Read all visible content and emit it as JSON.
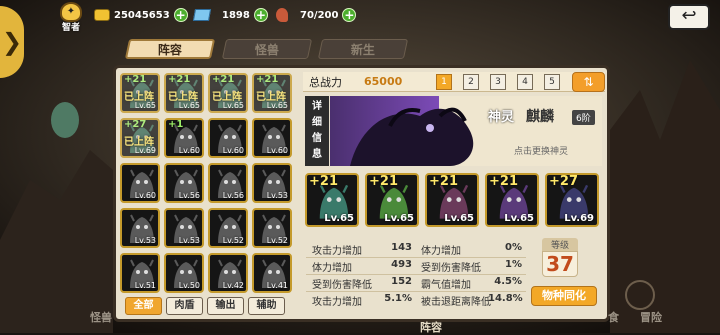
{
  "top": {
    "sage_label": "智者",
    "gold": "25045653",
    "diamond": "1898",
    "stamina": "70/200",
    "back_glyph": "↩"
  },
  "tabs": [
    {
      "label": "阵容",
      "active": true
    },
    {
      "label": "怪兽",
      "active": false
    },
    {
      "label": "新生",
      "active": false
    }
  ],
  "grid_cards": [
    {
      "star": "+21",
      "deployed": "已上阵",
      "level": "Lv.65"
    },
    {
      "star": "+21",
      "deployed": "已上阵",
      "level": "Lv.65"
    },
    {
      "star": "+21",
      "deployed": "已上阵",
      "level": "Lv.65"
    },
    {
      "star": "+21",
      "deployed": "已上阵",
      "level": "Lv.65"
    },
    {
      "star": "+27",
      "deployed": "已上阵",
      "level": "Lv.69"
    },
    {
      "star": "+1",
      "deployed": "",
      "level": "Lv.60"
    },
    {
      "star": "",
      "deployed": "",
      "level": "Lv.60"
    },
    {
      "star": "",
      "deployed": "",
      "level": "Lv.60"
    },
    {
      "star": "",
      "deployed": "",
      "level": "Lv.60"
    },
    {
      "star": "",
      "deployed": "",
      "level": "Lv.56"
    },
    {
      "star": "",
      "deployed": "",
      "level": "Lv.56"
    },
    {
      "star": "",
      "deployed": "",
      "level": "Lv.53"
    },
    {
      "star": "",
      "deployed": "",
      "level": "Lv.53"
    },
    {
      "star": "",
      "deployed": "",
      "level": "Lv.53"
    },
    {
      "star": "",
      "deployed": "",
      "level": "Lv.52"
    },
    {
      "star": "",
      "deployed": "",
      "level": "Lv.52"
    },
    {
      "star": "",
      "deployed": "",
      "level": "Lv.51"
    },
    {
      "star": "",
      "deployed": "",
      "level": "Lv.50"
    },
    {
      "star": "",
      "deployed": "",
      "level": "Lv.42"
    },
    {
      "star": "",
      "deployed": "",
      "level": "Lv.41"
    }
  ],
  "filters": [
    {
      "label": "全部",
      "active": true
    },
    {
      "label": "肉盾",
      "active": false
    },
    {
      "label": "输出",
      "active": false
    },
    {
      "label": "辅助",
      "active": false
    }
  ],
  "power": {
    "label": "总战力",
    "value": "65000"
  },
  "pages": [
    "1",
    "2",
    "3",
    "4",
    "5"
  ],
  "active_page": "1",
  "swap_glyph": "⇅",
  "detail_label": [
    "详",
    "细",
    "信",
    "息"
  ],
  "spirit": {
    "title": "神灵",
    "name": "麒麟",
    "rank": "6阶",
    "hint": "点击更换神灵"
  },
  "squad": [
    {
      "star": "+21",
      "level": "Lv.65"
    },
    {
      "star": "+21",
      "level": "Lv.65"
    },
    {
      "star": "+21",
      "level": "Lv.65"
    },
    {
      "star": "+21",
      "level": "Lv.65"
    },
    {
      "star": "+27",
      "level": "Lv.69"
    }
  ],
  "stats": [
    {
      "l_label": "攻击力增加",
      "l_value": "143",
      "r_label": "体力增加",
      "r_value": "0%"
    },
    {
      "l_label": "体力增加",
      "l_value": "493",
      "r_label": "受到伤害降低",
      "r_value": "1%"
    },
    {
      "l_label": "受到伤害降低",
      "l_value": "152",
      "r_label": "霸气值增加",
      "r_value": "4.5%"
    },
    {
      "l_label": "攻击力增加",
      "l_value": "5.1%",
      "r_label": "被击退距离降低",
      "r_value": "14.8%"
    }
  ],
  "grade": {
    "label": "等级",
    "value": "37"
  },
  "sync_label": "物种同化",
  "bottom": {
    "left": "怪兽",
    "right1": "食",
    "right2": "冒险",
    "center": "阵容"
  },
  "colors": {
    "accent": "#f3a827",
    "frame": "#c49a2b",
    "green": "#4cae2e"
  },
  "icons": [
    "lightbulb-icon",
    "gold-coin-icon",
    "diamond-icon",
    "meat-icon",
    "back-icon",
    "swap-icon"
  ]
}
